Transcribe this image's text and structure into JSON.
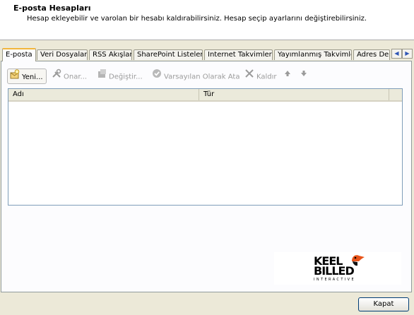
{
  "header": {
    "title": "E-posta Hesapları",
    "description": "Hesap ekleyebilir ve varolan bir hesabı kaldırabilirsiniz. Hesap seçip ayarlarını değiştirebilirsiniz."
  },
  "tabs": [
    {
      "label": "E-posta",
      "active": true
    },
    {
      "label": "Veri Dosyaları"
    },
    {
      "label": "RSS Akışları"
    },
    {
      "label": "SharePoint Listeleri"
    },
    {
      "label": "Internet Takvimleri"
    },
    {
      "label": "Yayımlanmış Takvimler"
    },
    {
      "label": "Adres De"
    }
  ],
  "toolbar": {
    "new": "Yeni...",
    "repair": "Onar...",
    "change": "Değiştir...",
    "set_default": "Varsayılan Olarak Ata",
    "remove": "Kaldır"
  },
  "list": {
    "columns": [
      "Adı",
      "Tür"
    ]
  },
  "logo": {
    "line1": "KEEL",
    "line2": "BILLED",
    "line3": "INTERACTIVE"
  },
  "footer": {
    "close": "Kapat"
  },
  "colors": {
    "dialog_bg": "#ece9d8",
    "active_tab_accent": "#f2b63c",
    "list_border": "#7f9db9"
  }
}
